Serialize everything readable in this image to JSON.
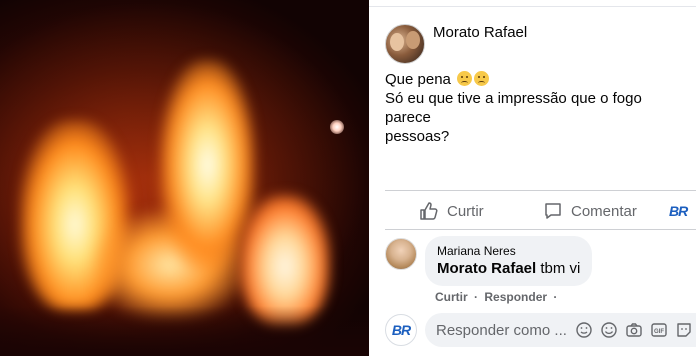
{
  "post": {
    "author": "Morato Rafael",
    "text_line1": "Que pena",
    "text_line2": "Só eu que tive a impressão que o fogo parece",
    "text_line3": "pessoas?",
    "emojis": [
      "sad-face",
      "sad-face"
    ]
  },
  "actions": {
    "like_label": "Curtir",
    "comment_label": "Comentar",
    "share_logo_text": "BR"
  },
  "comment": {
    "author": "Mariana Neres",
    "mention": "Morato Rafael",
    "text": "tbm vi",
    "like_label": "Curtir",
    "reply_label": "Responder",
    "separator": "·"
  },
  "reply_box": {
    "placeholder": "Responder como ...",
    "logo_text": "BR",
    "icons": [
      "sticker-icon",
      "emoji-icon",
      "camera-icon",
      "gif-icon",
      "sticker-face-icon"
    ]
  },
  "colors": {
    "text_primary": "#050505",
    "text_secondary": "#65676b",
    "bubble_bg": "#f0f2f5",
    "divider": "#ced0d4",
    "brand_blue": "#1c5fbf"
  }
}
